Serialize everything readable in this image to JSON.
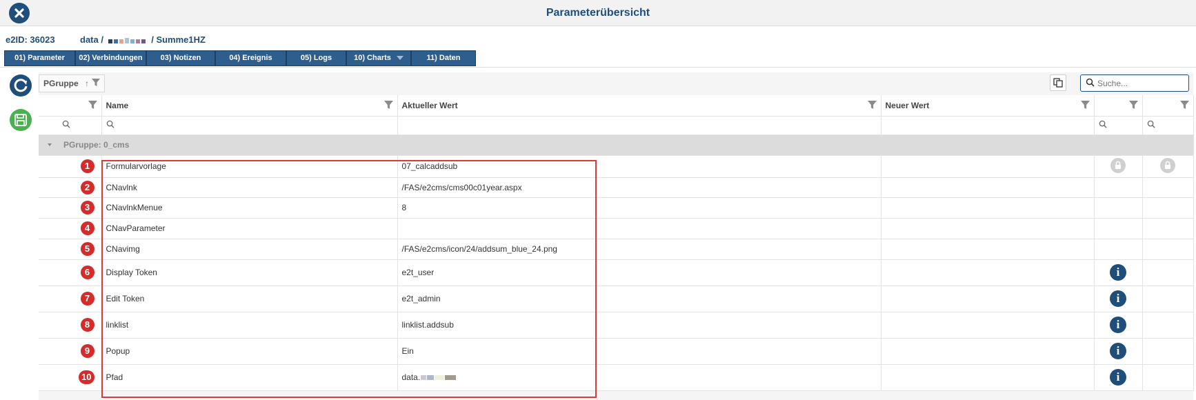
{
  "window": {
    "title": "Parameterübersicht"
  },
  "info": {
    "id_label": "e2ID:",
    "id_value": "36023",
    "path_prefix": "data /",
    "path_suffix": "/ Summe1HZ"
  },
  "tabs": [
    {
      "label": "01) Parameter"
    },
    {
      "label": "02) Verbindungen"
    },
    {
      "label": "03) Notizen"
    },
    {
      "label": "04) Ereignis"
    },
    {
      "label": "05) Logs"
    },
    {
      "label": "10) Charts"
    },
    {
      "label": "11) Daten"
    }
  ],
  "toolbar": {
    "group_chip": "PGruppe",
    "search_placeholder": "Suche..."
  },
  "columns": {
    "name": "Name",
    "current_value": "Aktueller Wert",
    "new_value": "Neuer Wert"
  },
  "group": {
    "label": "PGruppe: 0_cms"
  },
  "rows": [
    {
      "num": "1",
      "name": "Formularvorlage",
      "value": "07_calcaddsub",
      "icon_a": "lock-icon",
      "icon_b": "lock-icon"
    },
    {
      "num": "2",
      "name": "CNavlnk",
      "value": "/FAS/e2cms/cms00c01year.aspx"
    },
    {
      "num": "3",
      "name": "CNavlnkMenue",
      "value": "8"
    },
    {
      "num": "4",
      "name": "CNavParameter",
      "value": ""
    },
    {
      "num": "5",
      "name": "CNavimg",
      "value": "/FAS/e2cms/icon/24/addsum_blue_24.png"
    },
    {
      "num": "6",
      "name": "Display Token",
      "value": "e2t_user",
      "icon_a": "info-icon"
    },
    {
      "num": "7",
      "name": "Edit Token",
      "value": "e2t_admin",
      "icon_a": "info-icon"
    },
    {
      "num": "8",
      "name": "linklist",
      "value": "linklist.addsub",
      "icon_a": "info-icon"
    },
    {
      "num": "9",
      "name": "Popup",
      "value": "Ein",
      "icon_a": "info-icon"
    },
    {
      "num": "10",
      "name": "Pfad",
      "value": "data.",
      "icon_a": "info-icon"
    }
  ],
  "colors": {
    "accent": "#1f4e7a",
    "tab": "#2e5e8e",
    "marker": "#d52b2b",
    "save": "#4caf50",
    "highlight": "#d63a3a"
  }
}
